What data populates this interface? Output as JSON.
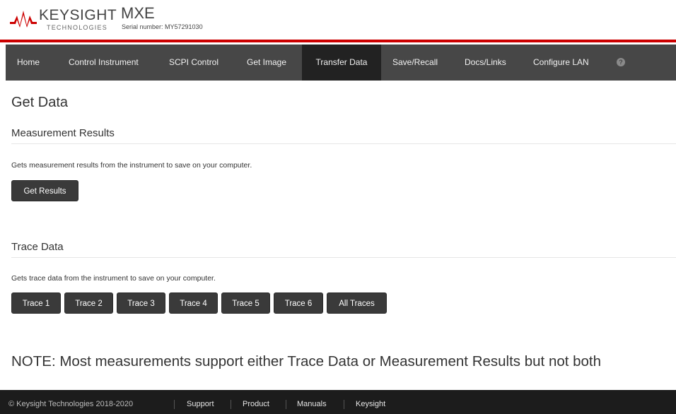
{
  "brand": {
    "logo_word": "KEYSIGHT",
    "logo_sub": "TECHNOLOGIES",
    "product": "MXE",
    "serial": "Serial number: MY57291030",
    "accent_color": "#cc0000"
  },
  "nav": {
    "items": [
      {
        "label": "Home"
      },
      {
        "label": "Control Instrument"
      },
      {
        "label": "SCPI Control"
      },
      {
        "label": "Get Image"
      },
      {
        "label": "Transfer Data",
        "active": true
      },
      {
        "label": "Save/Recall"
      },
      {
        "label": "Docs/Links"
      },
      {
        "label": "Configure LAN"
      }
    ],
    "help_icon": "question-circle-icon",
    "help_glyph": "?"
  },
  "main": {
    "title": "Get Data",
    "measurement": {
      "heading": "Measurement Results",
      "description": "Gets measurement results from the instrument to save on your computer.",
      "button": "Get Results"
    },
    "trace": {
      "heading": "Trace Data",
      "description": "Gets trace data from the instrument to save on your computer.",
      "buttons": [
        "Trace 1",
        "Trace 2",
        "Trace 3",
        "Trace 4",
        "Trace 5",
        "Trace 6",
        "All Traces"
      ]
    },
    "note": "NOTE: Most measurements support either Trace Data or Measurement Results but not both"
  },
  "footer": {
    "copyright": "© Keysight Technologies 2018-2020",
    "links": [
      "Support",
      "Product",
      "Manuals",
      "Keysight"
    ]
  }
}
